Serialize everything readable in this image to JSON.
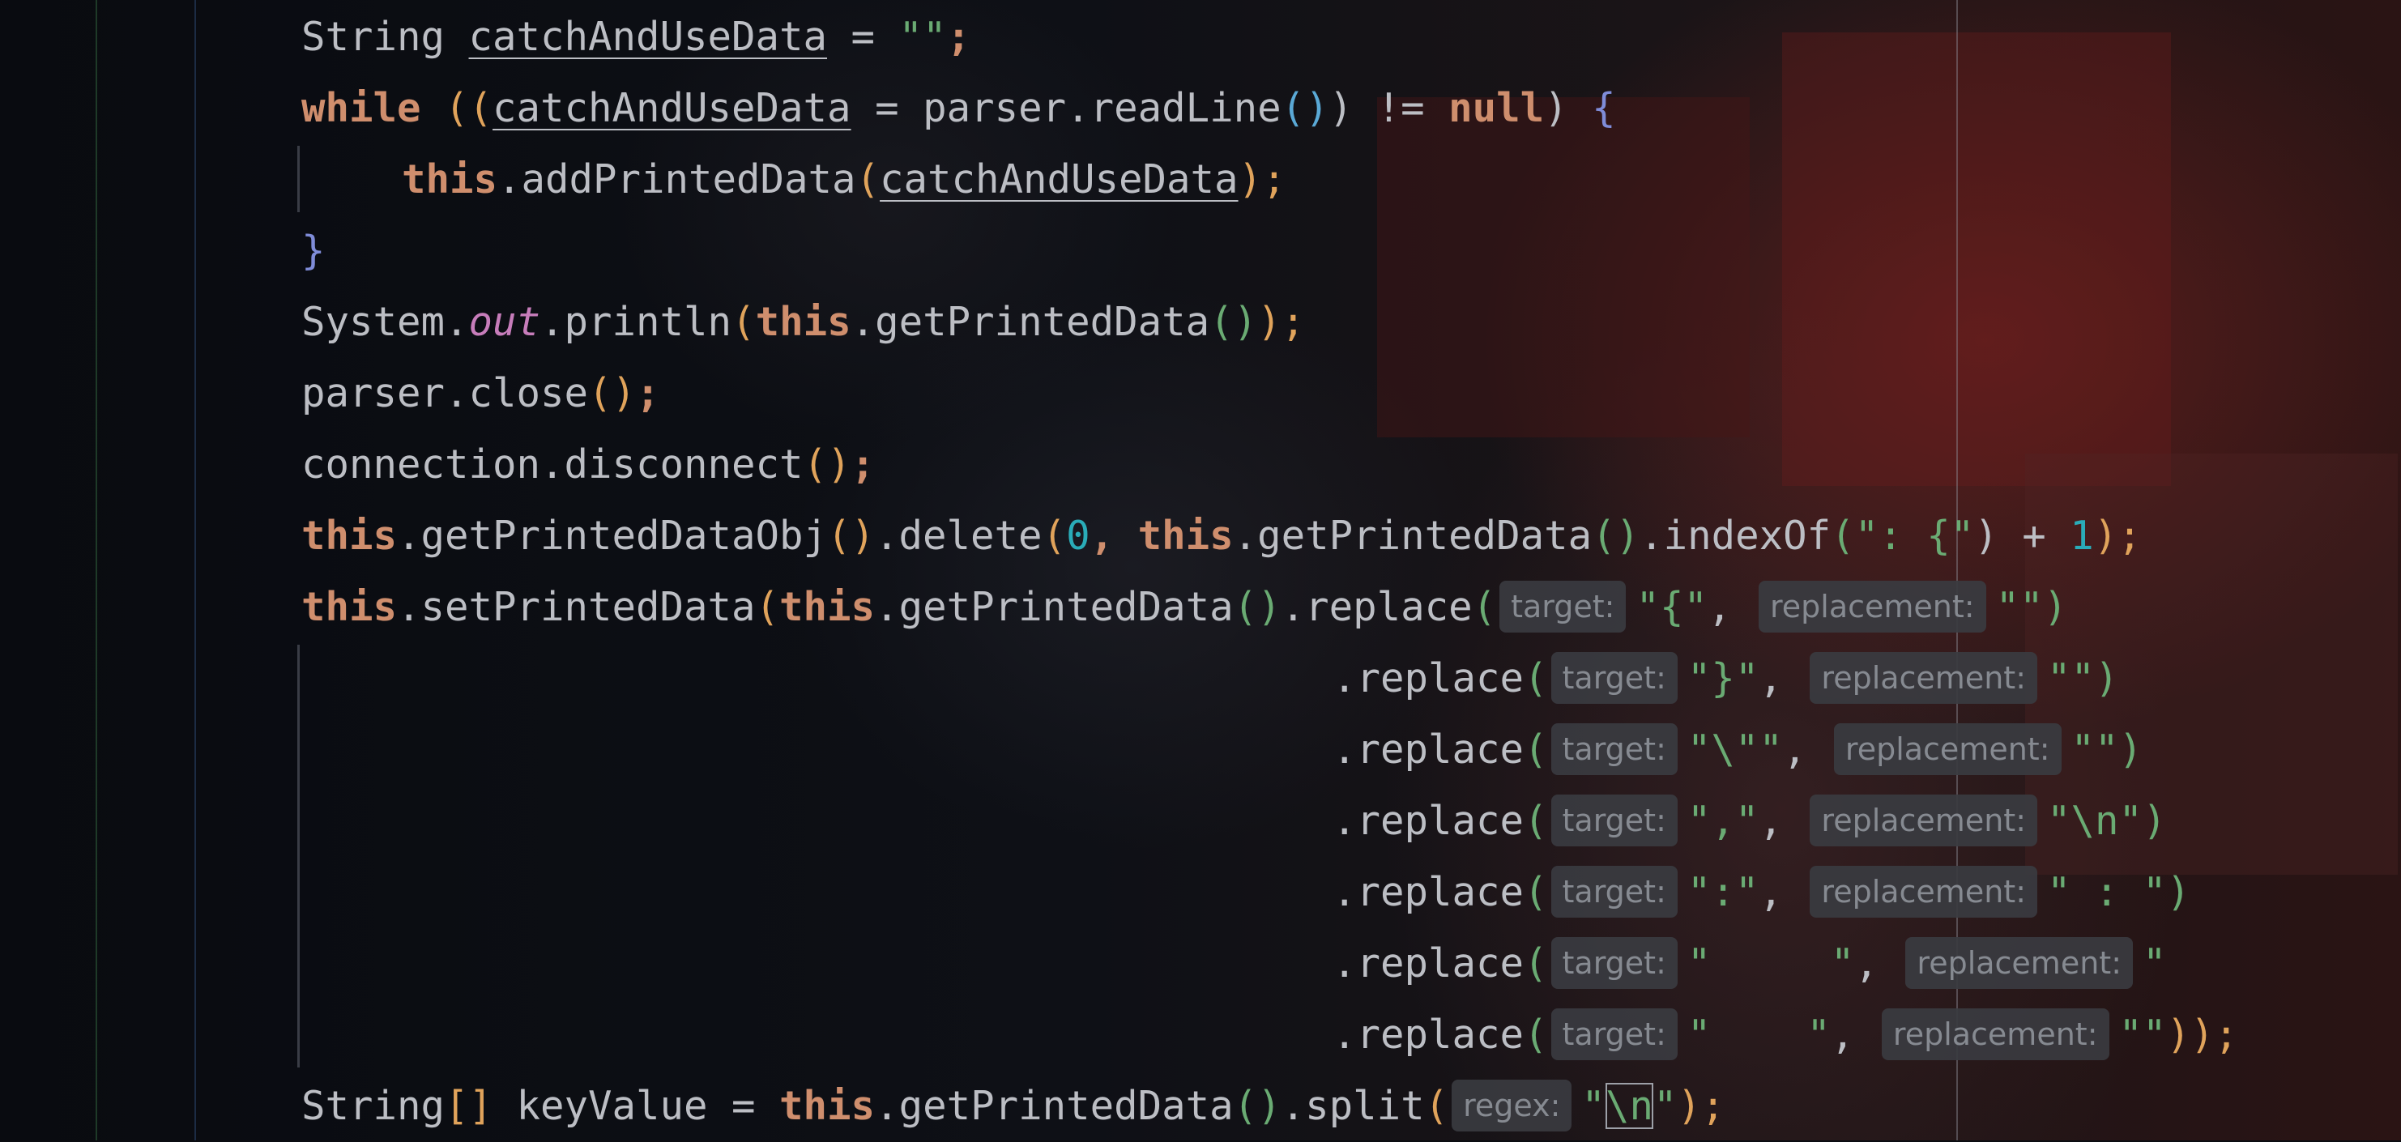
{
  "editor": {
    "language": "java",
    "theme_colors": {
      "keyword": "#cf8e6d",
      "string": "#6aab73",
      "number": "#2aacb8",
      "static_field": "#c77dbb",
      "text": "#bcbec4",
      "inlay_hint_bg": "#393b40",
      "inlay_hint_text": "#868a91"
    },
    "code_lines": [
      {
        "tokens": [
          "String ",
          "catchAndUseData",
          " = ",
          "\"\"",
          ";"
        ]
      },
      {
        "tokens": [
          "while",
          " ",
          "((",
          "catchAndUseData",
          " = parser.readLine",
          "()",
          ") != ",
          "null",
          ") ",
          "{"
        ]
      },
      {
        "tokens": [
          "this",
          ".addPrintedData",
          "(",
          "catchAndUseData",
          ");"
        ]
      },
      {
        "tokens": [
          "}"
        ]
      },
      {
        "tokens": [
          "System.",
          "out",
          ".println",
          "(",
          "this",
          ".getPrintedData",
          "()",
          ");"
        ]
      },
      {
        "tokens": [
          "parser.close",
          "()",
          ";"
        ]
      },
      {
        "tokens": [
          "connection.disconnect",
          "()",
          ";"
        ]
      },
      {
        "tokens": [
          "this",
          ".getPrintedDataObj",
          "()",
          ".delete",
          "(",
          "0",
          ", ",
          "this",
          ".getPrintedData",
          "()",
          ".indexOf",
          "(",
          "\": {\"",
          ") + ",
          "1",
          ");"
        ]
      },
      {
        "tokens": [
          "this",
          ".setPrintedData",
          "(",
          "this",
          ".getPrintedData",
          "()",
          ".replace",
          "(",
          "target:",
          "\"{\"",
          ", ",
          "replacement:",
          "\"\"",
          ")"
        ]
      },
      {
        "tokens": [
          ".replace",
          "(",
          "target:",
          "\"}\"",
          ", ",
          "replacement:",
          "\"\"",
          ")"
        ]
      },
      {
        "tokens": [
          ".replace",
          "(",
          "target:",
          "\"\\\"\"",
          ", ",
          "replacement:",
          "\"\"",
          ")"
        ]
      },
      {
        "tokens": [
          ".replace",
          "(",
          "target:",
          "\",\"",
          ", ",
          "replacement:",
          "\"\\n\"",
          ")"
        ]
      },
      {
        "tokens": [
          ".replace",
          "(",
          "target:",
          "\":\"",
          ", ",
          "replacement:",
          "\" : \"",
          ")"
        ]
      },
      {
        "tokens": [
          ".replace",
          "(",
          "target:",
          "\"     \"",
          ", ",
          "replacement:",
          "\"    ",
          ")"
        ]
      },
      {
        "tokens": [
          ".replace",
          "(",
          "target:",
          "\"    \"",
          ", ",
          "replacement:",
          "\"\"",
          "));"
        ]
      },
      {
        "tokens": [
          "String",
          "[]",
          " keyValue = ",
          "this",
          ".getPrintedData",
          "()",
          ".split",
          "(",
          "regex:",
          "\"",
          "\\n",
          "\"",
          ");"
        ]
      }
    ]
  }
}
